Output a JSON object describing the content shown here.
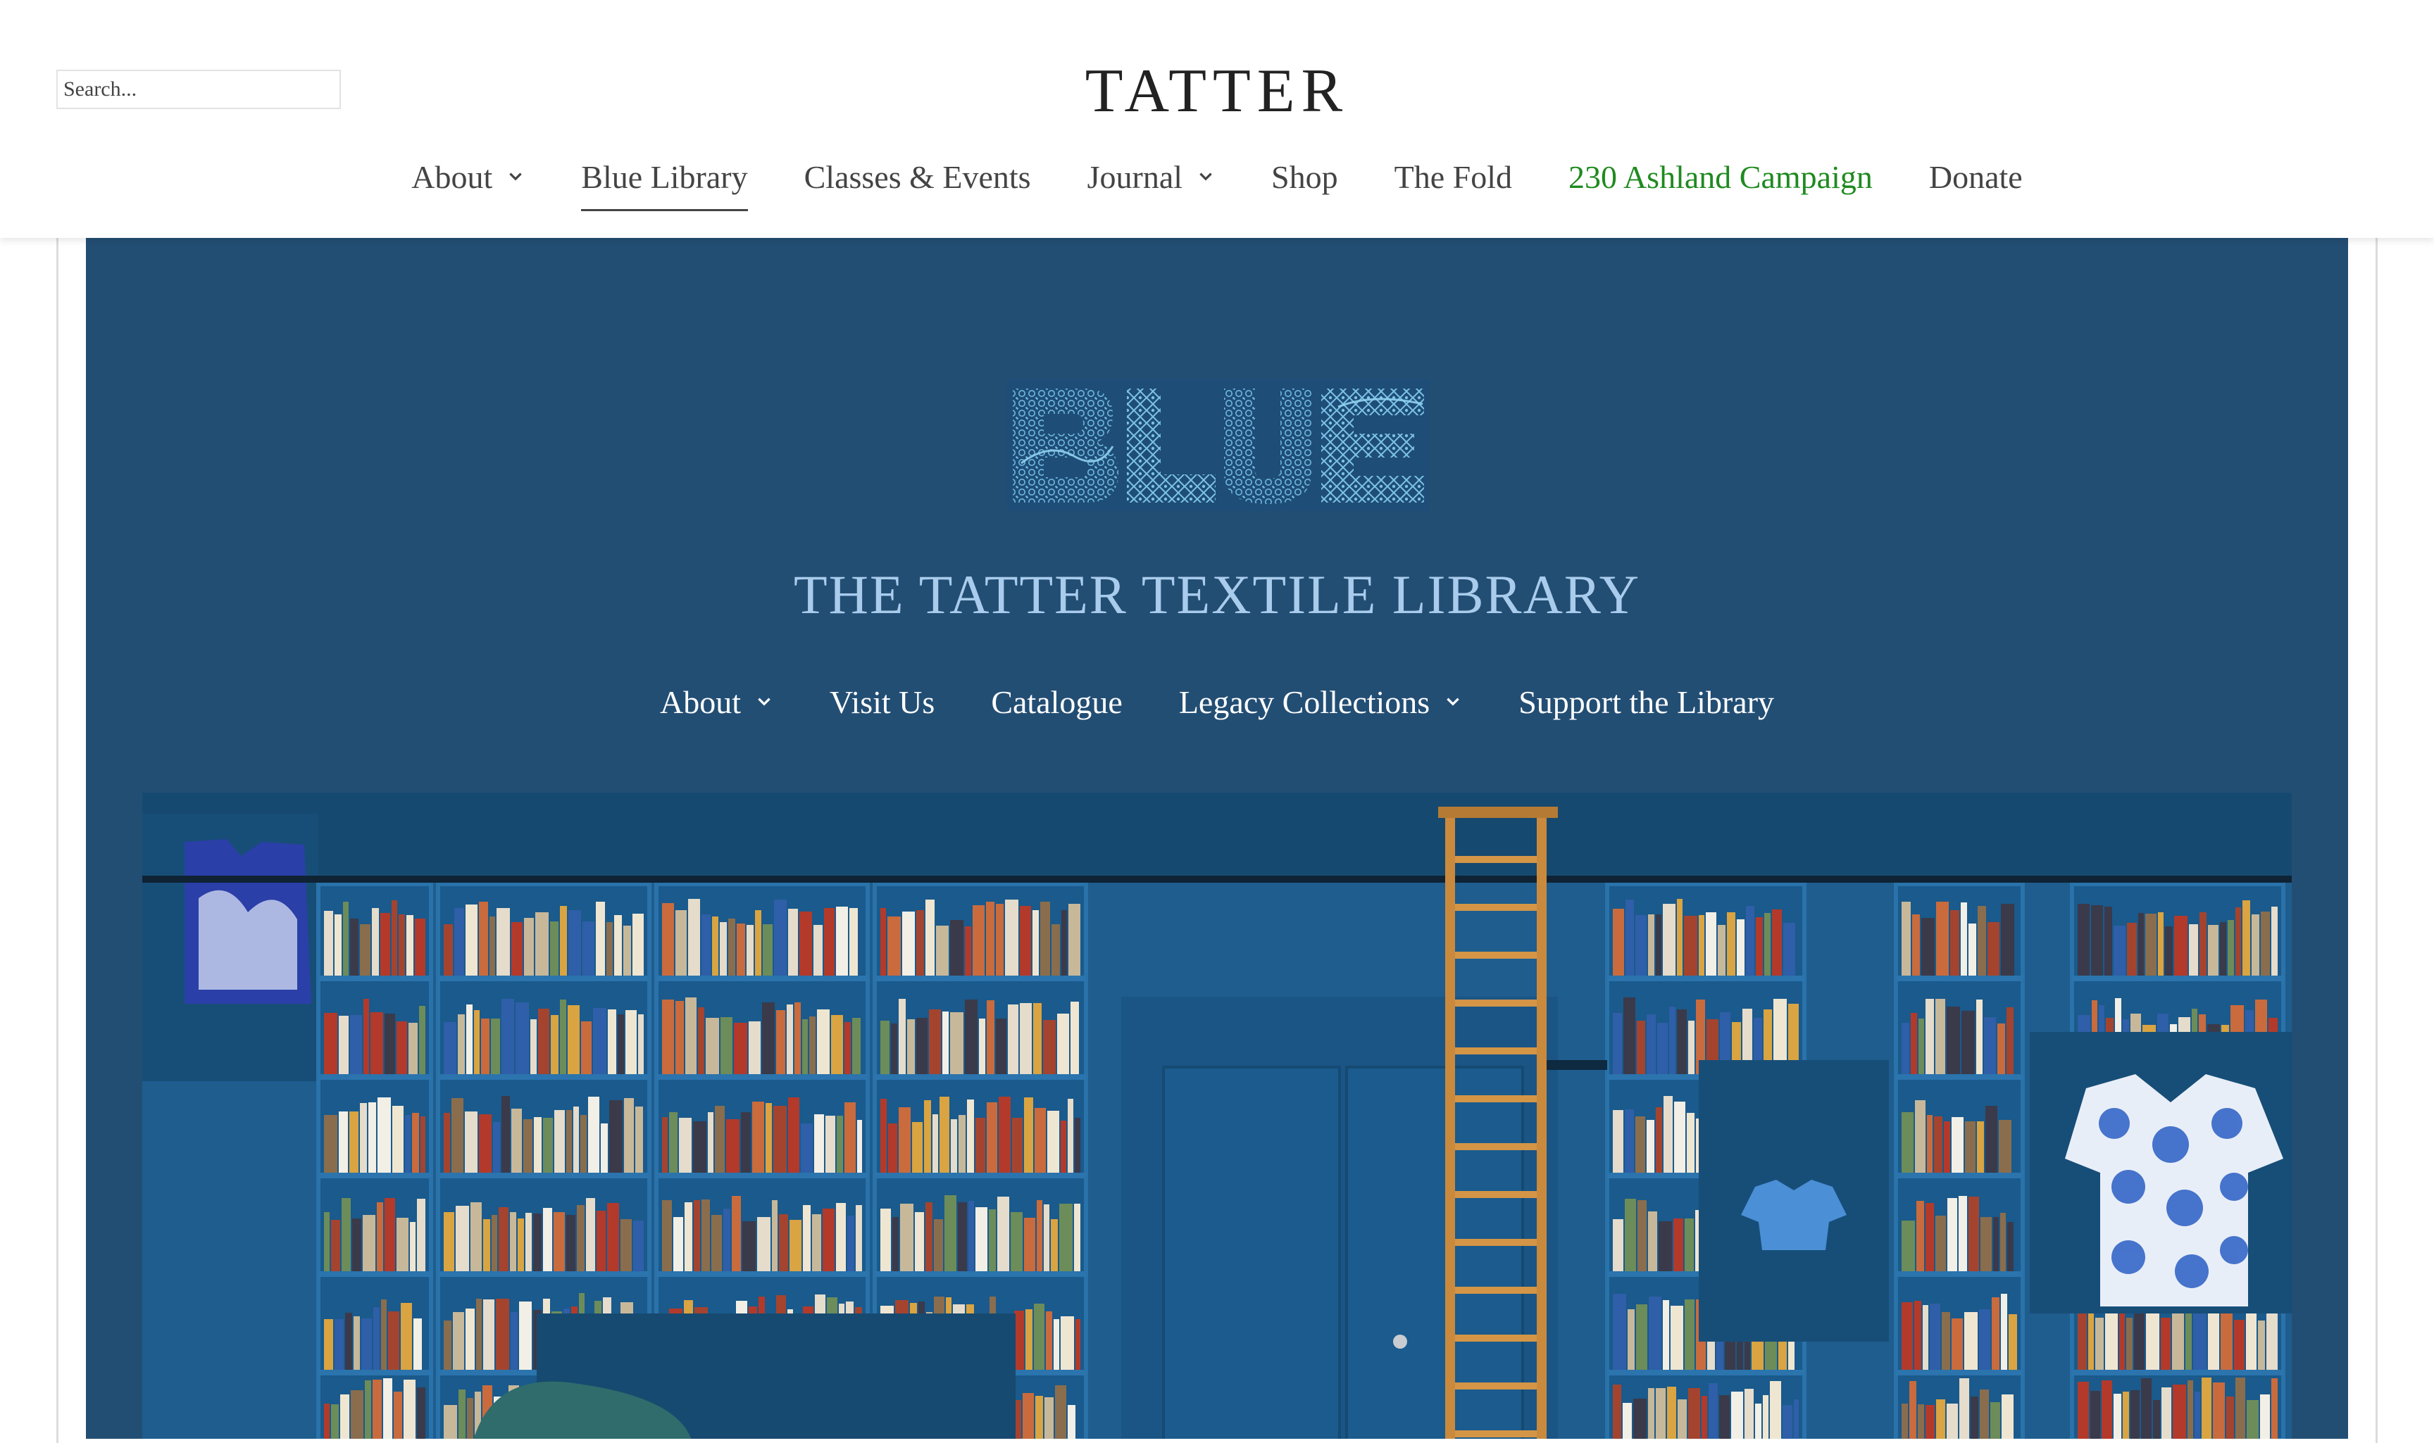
{
  "header": {
    "search_placeholder": "Search...",
    "logo_text": "TATTER",
    "nav": [
      {
        "label": "About",
        "has_dropdown": true
      },
      {
        "label": "Blue Library",
        "active": true
      },
      {
        "label": "Classes & Events"
      },
      {
        "label": "Journal",
        "has_dropdown": true
      },
      {
        "label": "Shop"
      },
      {
        "label": "The Fold"
      },
      {
        "label": "230 Ashland Campaign",
        "color": "#1f8a1f"
      },
      {
        "label": "Donate"
      }
    ]
  },
  "library": {
    "logo_text": "BLUE",
    "title": "THE TATTER TEXTILE LIBRARY",
    "nav": [
      {
        "label": "About",
        "has_dropdown": true
      },
      {
        "label": "Visit Us"
      },
      {
        "label": "Catalogue"
      },
      {
        "label": "Legacy Collections",
        "has_dropdown": true
      },
      {
        "label": "Support the Library"
      }
    ],
    "background_color": "#234e74",
    "title_color": "#a9ccec"
  },
  "icons": {
    "dropdown": "chevron-down-icon"
  }
}
